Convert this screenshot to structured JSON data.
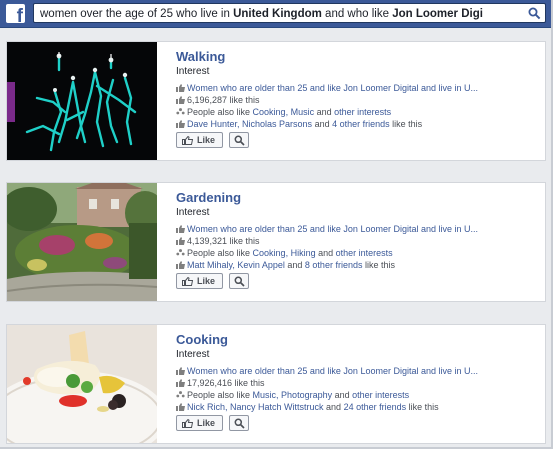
{
  "search": {
    "prefix": "women over the age of 25 who live in ",
    "location": "United Kingdom",
    "middle": " and who like ",
    "page": "Jon Loomer Digi"
  },
  "results": [
    {
      "title": "Walking",
      "category": "Interest",
      "line1": "Women who are older than 25 and like Jon Loomer Digital and live in U...",
      "likes": "6,196,287 like this",
      "also_prefix": "People also like ",
      "also_links": "Cooking, Music",
      "also_mid": " and ",
      "also_end": "other interests",
      "friends_names": "Dave Hunter, Nicholas Parsons",
      "friends_mid": " and ",
      "friends_count": "4 other friends",
      "friends_suffix": " like this",
      "like_label": "Like"
    },
    {
      "title": "Gardening",
      "category": "Interest",
      "line1": "Women who are older than 25 and like Jon Loomer Digital and live in U...",
      "likes": "4,139,321 like this",
      "also_prefix": "People also like ",
      "also_links": "Cooking, Hiking",
      "also_mid": " and ",
      "also_end": "other interests",
      "friends_names": "Matt Mihaly, Kevin Appel",
      "friends_mid": " and ",
      "friends_count": "8 other friends",
      "friends_suffix": " like this",
      "like_label": "Like"
    },
    {
      "title": "Cooking",
      "category": "Interest",
      "line1": "Women who are older than 25 and like Jon Loomer Digital and live in U...",
      "likes": "17,926,416 like this",
      "also_prefix": "People also like ",
      "also_links": "Music, Photography",
      "also_mid": " and ",
      "also_end": "other interests",
      "friends_names": "Nick Rich, Nancy Hatch Wittstruck",
      "friends_mid": " and ",
      "friends_count": "24 other friends",
      "friends_suffix": " like this",
      "like_label": "Like"
    }
  ],
  "colors": {
    "brand": "#3b5998",
    "link": "#3b5998",
    "background": "#e9ebee"
  },
  "icons": [
    "facebook-logo-icon",
    "search-icon",
    "thumbs-up-icon",
    "people-icon",
    "magnifier-icon"
  ]
}
